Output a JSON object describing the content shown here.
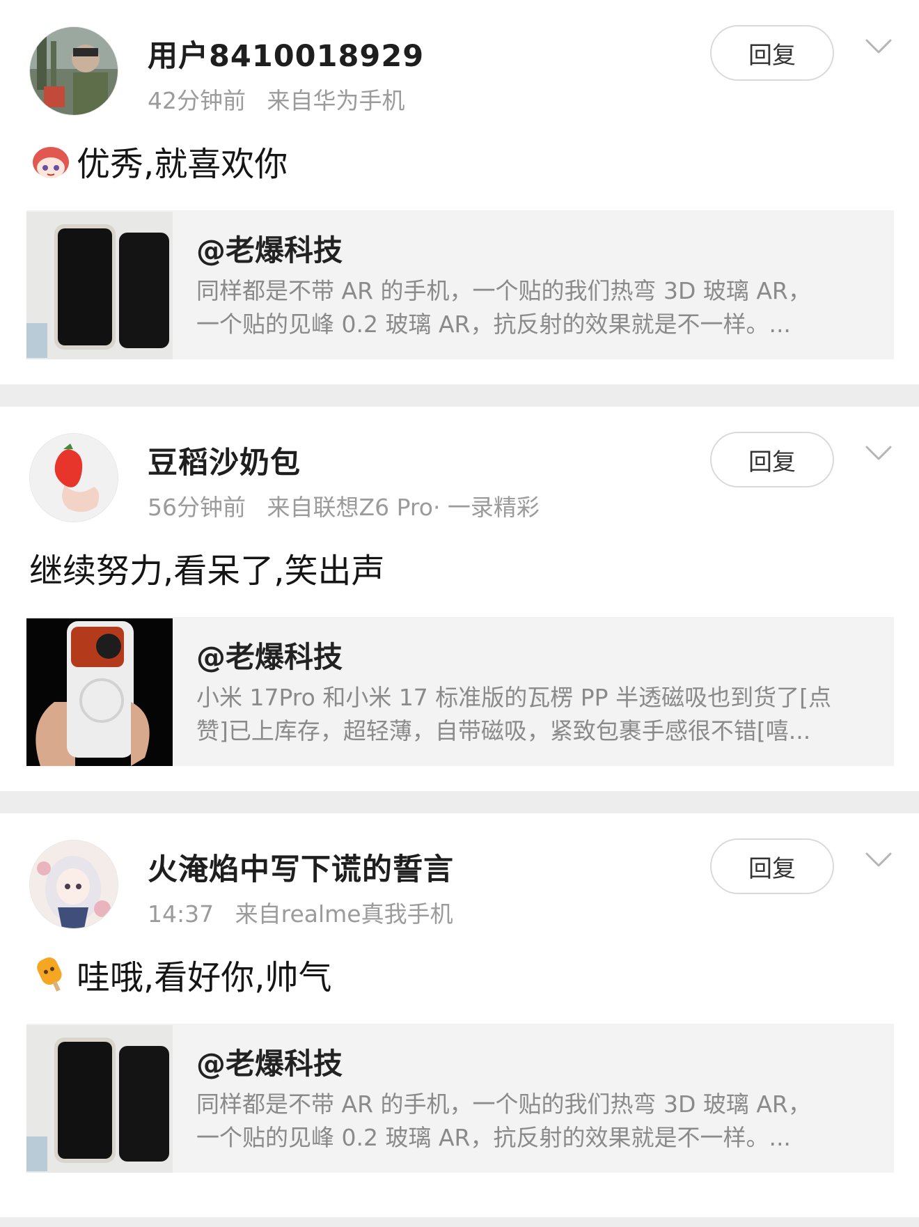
{
  "reply_label": "回复",
  "posts": [
    {
      "username": "用户8410018929",
      "time": "42分钟前",
      "source": "来自华为手机",
      "comment": "优秀,就喜欢你",
      "quote": {
        "author": "@老爆科技",
        "line1": "同样都是不带 AR 的手机，一个贴的我们热弯 3D 玻璃 AR，",
        "line2": "一个贴的见峰 0.2 玻璃 AR，抗反射的效果就是不一样。..."
      }
    },
    {
      "username": "豆稻沙奶包",
      "time": "56分钟前",
      "source": "来自联想Z6 Pro· 一录精彩",
      "comment": "继续努力,看呆了,笑出声",
      "quote": {
        "author": "@老爆科技",
        "line1": "小米 17Pro 和小米 17 标准版的瓦楞 PP 半透磁吸也到货了[点",
        "line2": "赞]已上库存，超轻薄，自带磁吸，紧致包裹手感很不错[嘻..."
      }
    },
    {
      "username": "火淹焰中写下谎的誓言",
      "time": "14:37",
      "source": "来自realme真我手机",
      "comment": "哇哦,看好你,帅气",
      "quote": {
        "author": "@老爆科技",
        "line1": "同样都是不带 AR 的手机，一个贴的我们热弯 3D 玻璃 AR，",
        "line2": "一个贴的见峰 0.2 玻璃 AR，抗反射的效果就是不一样。..."
      }
    }
  ]
}
